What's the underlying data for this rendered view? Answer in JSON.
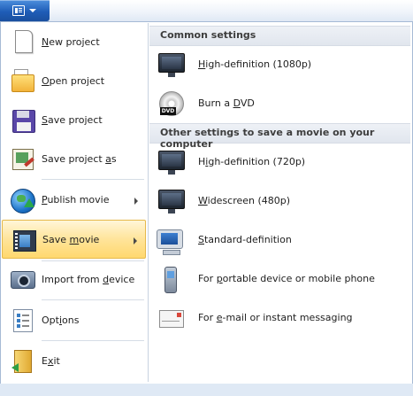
{
  "menu": {
    "left_items": [
      {
        "key": "new",
        "pre": "",
        "ul": "N",
        "post": "ew project",
        "icon": "new-project-icon"
      },
      {
        "key": "open",
        "pre": "",
        "ul": "O",
        "post": "pen project",
        "icon": "open-project-icon"
      },
      {
        "key": "save",
        "pre": "",
        "ul": "S",
        "post": "ave project",
        "icon": "save-project-icon"
      },
      {
        "key": "saveas",
        "pre": "Save project ",
        "ul": "a",
        "post": "s",
        "icon": "save-project-as-icon"
      },
      {
        "key": "publish",
        "pre": "",
        "ul": "P",
        "post": "ublish movie",
        "icon": "publish-movie-icon",
        "submenu": true
      },
      {
        "key": "savemovie",
        "pre": "Save ",
        "ul": "m",
        "post": "ovie",
        "icon": "save-movie-icon",
        "submenu": true,
        "selected": true
      },
      {
        "key": "import",
        "pre": "Import from ",
        "ul": "d",
        "post": "evice",
        "icon": "import-device-icon"
      },
      {
        "key": "options",
        "pre": "Opt",
        "ul": "i",
        "post": "ons",
        "icon": "options-icon"
      },
      {
        "key": "exit",
        "pre": "E",
        "ul": "x",
        "post": "it",
        "icon": "exit-icon"
      }
    ]
  },
  "submenu": {
    "section1_title": "Common settings",
    "section2_title": "Other settings to save a movie on your computer",
    "items": [
      {
        "key": "hd1080",
        "pre": "",
        "ul": "H",
        "post": "igh-definition (1080p)",
        "icon": "hd-monitor-icon"
      },
      {
        "key": "dvd",
        "pre": "Burn a ",
        "ul": "D",
        "post": "VD",
        "icon": "dvd-icon",
        "tag": "DVD"
      },
      {
        "key": "hd720",
        "pre": "H",
        "ul": "i",
        "post": "gh-definition (720p)",
        "icon": "hd-monitor-icon"
      },
      {
        "key": "wide",
        "pre": "",
        "ul": "W",
        "post": "idescreen (480p)",
        "icon": "widescreen-monitor-icon"
      },
      {
        "key": "sd",
        "pre": "",
        "ul": "S",
        "post": "tandard-definition",
        "icon": "computer-monitor-icon"
      },
      {
        "key": "portable",
        "pre": "For ",
        "ul": "p",
        "post": "ortable device or mobile phone",
        "icon": "mobile-phone-icon"
      },
      {
        "key": "email",
        "pre": "For ",
        "ul": "e",
        "post": "-mail or instant messaging",
        "icon": "email-envelope-icon"
      }
    ]
  }
}
